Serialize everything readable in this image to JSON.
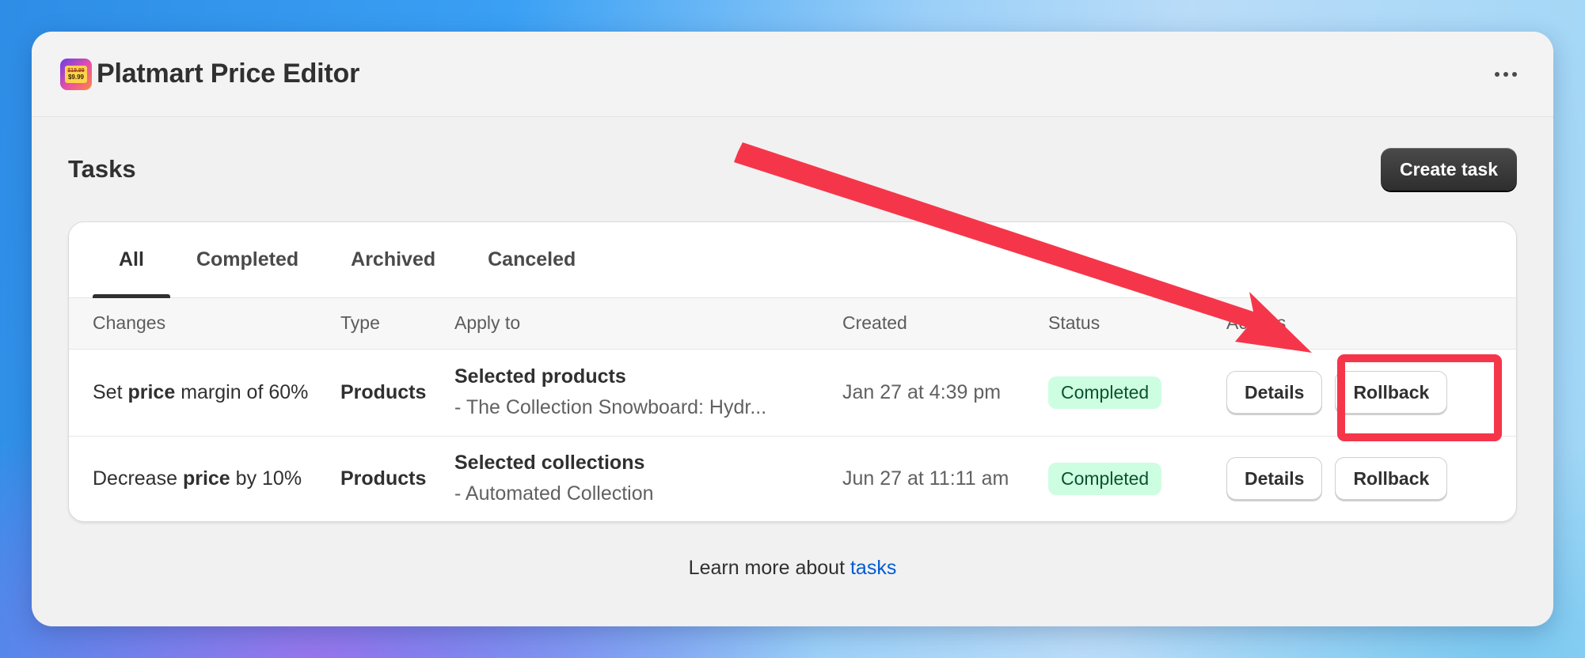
{
  "app": {
    "title": "Platmart Price Editor",
    "logo_old_price": "$19.99",
    "logo_new_price": "$9.99"
  },
  "page": {
    "title": "Tasks",
    "create_button": "Create task"
  },
  "tabs": [
    {
      "label": "All",
      "active": true
    },
    {
      "label": "Completed",
      "active": false
    },
    {
      "label": "Archived",
      "active": false
    },
    {
      "label": "Canceled",
      "active": false
    }
  ],
  "table": {
    "headers": [
      "Changes",
      "Type",
      "Apply to",
      "Created",
      "Status",
      "Actions"
    ],
    "rows": [
      {
        "change_prefix": "Set ",
        "change_bold": "price",
        "change_suffix": " margin of 60%",
        "type": "Products",
        "apply_title": "Selected products",
        "apply_detail": "- The Collection Snowboard: Hydr...",
        "created": "Jan 27 at 4:39 pm",
        "status": "Completed",
        "details_label": "Details",
        "rollback_label": "Rollback"
      },
      {
        "change_prefix": "Decrease ",
        "change_bold": "price",
        "change_suffix": " by 10%",
        "type": "Products",
        "apply_title": "Selected collections",
        "apply_detail": "- Automated Collection",
        "created": "Jun 27 at 11:11 am",
        "status": "Completed",
        "details_label": "Details",
        "rollback_label": "Rollback"
      }
    ]
  },
  "footer": {
    "text": "Learn more about ",
    "link": "tasks"
  },
  "colors": {
    "annotation": "#f5364a",
    "badge_bg": "#cdfee1",
    "link": "#005bd3"
  }
}
